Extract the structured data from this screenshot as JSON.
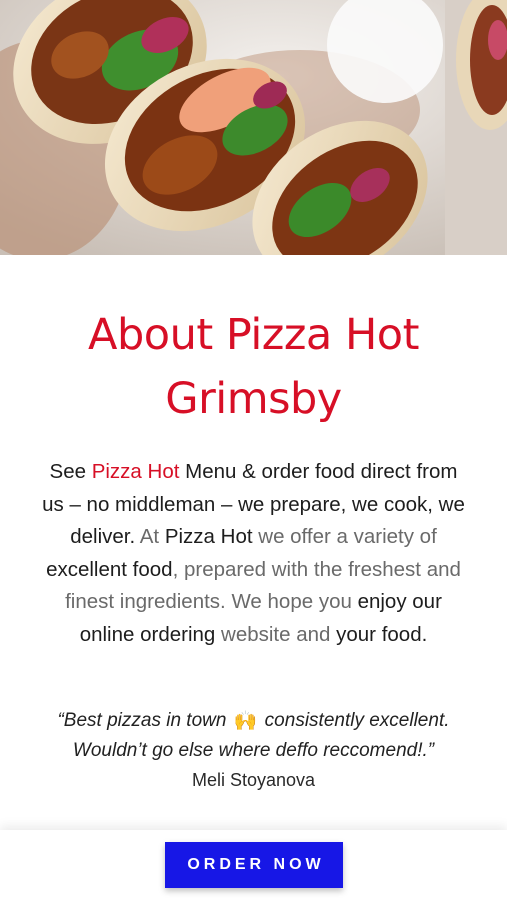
{
  "hero": {
    "image_description_icon": "wrap-food-image"
  },
  "about": {
    "title": "About Pizza Hot Grimsby",
    "paragraph": {
      "p1": "See ",
      "p2": "Pizza Hot",
      "p3": " Menu & order food direct from us – no middleman – we prepare, we cook, we deliver.",
      "p4": " At ",
      "p5": "Pizza Hot",
      "p6": " we offer a variety of ",
      "p7": "excellent food",
      "p8": ", prepared with the freshest and finest ingredients. We hope you ",
      "p9": "enjoy our online ordering",
      "p10": " website and ",
      "p11": "your food",
      "p12": "."
    }
  },
  "testimonial": {
    "quote_start": "“Best pizzas in town",
    "emoji": "🙌",
    "quote_end": " consistently excellent. Wouldn’t go else where deffo reccomend!.”",
    "author": "Meli Stoyanova"
  },
  "cta": {
    "order_label": "ORDER NOW"
  },
  "colors": {
    "brand_red": "#d70f26",
    "button_blue": "#1717e6"
  }
}
